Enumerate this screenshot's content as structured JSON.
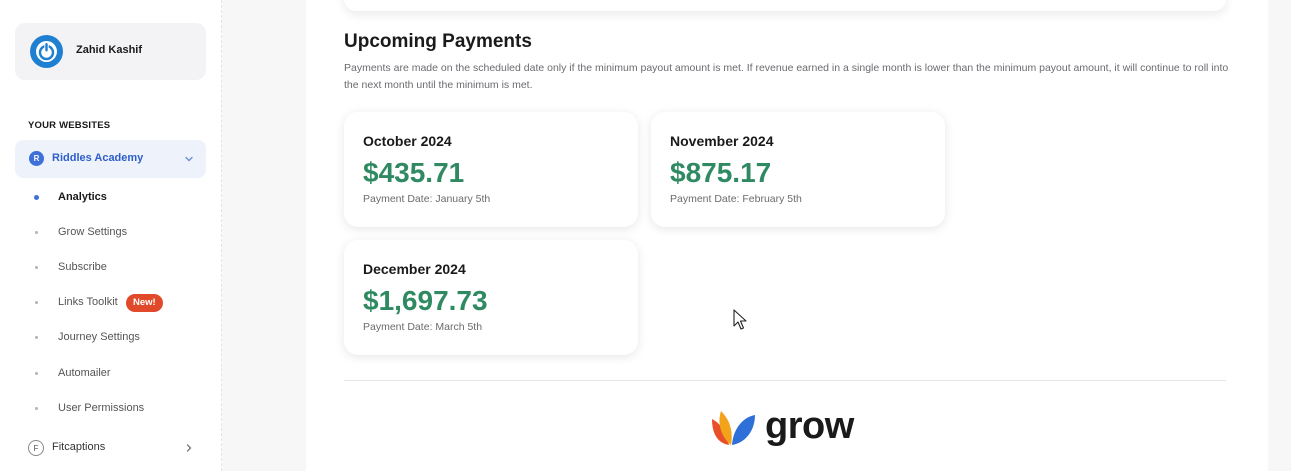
{
  "user": {
    "name": "Zahid Kashif",
    "avatar_icon": "power-icon"
  },
  "sidebar": {
    "section_title": "YOUR WEBSITES",
    "active_site": {
      "badge": "R",
      "name": "Riddles Academy"
    },
    "items": [
      {
        "label": "Analytics",
        "active": true
      },
      {
        "label": "Grow Settings"
      },
      {
        "label": "Subscribe"
      },
      {
        "label": "Links Toolkit",
        "badge": "New!"
      },
      {
        "label": "Journey Settings"
      },
      {
        "label": "Automailer"
      },
      {
        "label": "User Permissions"
      }
    ],
    "other_site": {
      "badge": "F",
      "name": "Fitcaptions"
    }
  },
  "main": {
    "title": "Upcoming Payments",
    "description": "Payments are made on the scheduled date only if the minimum payout amount is met. If revenue earned in a single month is lower than the minimum payout amount, it will continue to roll into the next month until the minimum is met.",
    "payments": [
      {
        "month": "October 2024",
        "amount": "$435.71",
        "date": "Payment Date: January 5th"
      },
      {
        "month": "November 2024",
        "amount": "$875.17",
        "date": "Payment Date: February 5th"
      },
      {
        "month": "December 2024",
        "amount": "$1,697.73",
        "date": "Payment Date: March 5th"
      }
    ],
    "footer_logo": "grow"
  },
  "colors": {
    "accent": "#3f6fd8",
    "money": "#2f8a62",
    "new_badge": "#e04a2a"
  }
}
